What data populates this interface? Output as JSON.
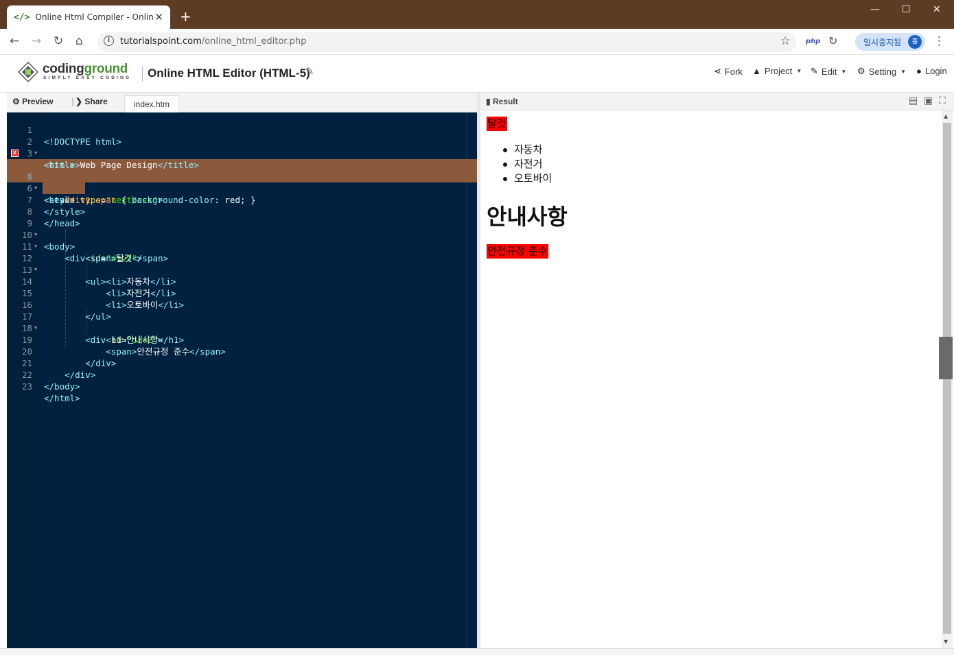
{
  "browser": {
    "tab_title": "Online Html Compiler - Online H",
    "url_host": "tutorialspoint.com",
    "url_path": "/online_html_editor.php",
    "ext_php": "php",
    "profile_label": "일시중지됨",
    "profile_initial": "흠"
  },
  "site": {
    "logo_main": "coding",
    "logo_accent": "ground",
    "logo_tagline": "SIMPLY EASY CODING",
    "title": "Online HTML Editor (HTML-5)",
    "menu": {
      "fork": "Fork",
      "project": "Project",
      "edit": "Edit",
      "setting": "Setting",
      "login": "Login"
    }
  },
  "editor": {
    "preview_label": "Preview",
    "share_label": "Share",
    "file_tab": "index.htm",
    "line_numbers": [
      "1",
      "2",
      "3",
      "4",
      "5",
      "6",
      "7",
      "8",
      "9",
      "10",
      "11",
      "12",
      "13",
      "14",
      "15",
      "16",
      "17",
      "18",
      "19",
      "20",
      "21",
      "22",
      "23"
    ],
    "code": {
      "l1": "<!DOCTYPE html>",
      "l2": "<html>",
      "l3a": "<title>",
      "l3b": "Web Page Design",
      "l3c": "</title>",
      "l4": "<head>",
      "l5a": "<style ",
      "l5b": "type",
      "l5c": "=",
      "l5d": "\"text/css\"",
      "l5e": ">",
      "l6a": "    #div1 span",
      "l6b": " { ",
      "l6c": "background-color",
      "l6d": ": red; }",
      "l7": "</style>",
      "l8": "</head>",
      "l9": "<body>",
      "l10a": "    <div ",
      "l10b": "id",
      "l10c": "=",
      "l10d": "\"div1\"",
      "l10e": ">",
      "l11a": "        <span>",
      "l11b": "탈것",
      "l11c": "</span>",
      "l12": "        <ul>",
      "l13a": "            <li>",
      "l13b": "자동차",
      "l13c": "</li>",
      "l14a": "            <li>",
      "l14b": "자전거",
      "l14c": "</li>",
      "l15a": "            <li>",
      "l15b": "오토바이",
      "l15c": "</li>",
      "l16": "        </ul>",
      "l17a": "        <div ",
      "l17b": "id",
      "l17c": "=",
      "l17d": "\"div2\"",
      "l17e": ">",
      "l18a": "            <h1>",
      "l18b": "안내사항",
      "l18c": "</h1>",
      "l19a": "            <span>",
      "l19b": "안전규정 준수",
      "l19c": "</span>",
      "l20": "        </div>",
      "l21": "    </div>",
      "l22": "</body>",
      "l23": "</html>"
    },
    "error_line": "4"
  },
  "result": {
    "label": "Result",
    "span1": "탈것",
    "list": [
      "자동차",
      "자전거",
      "오토바이"
    ],
    "heading": "안내사항",
    "span2": "안전규정 준수"
  }
}
